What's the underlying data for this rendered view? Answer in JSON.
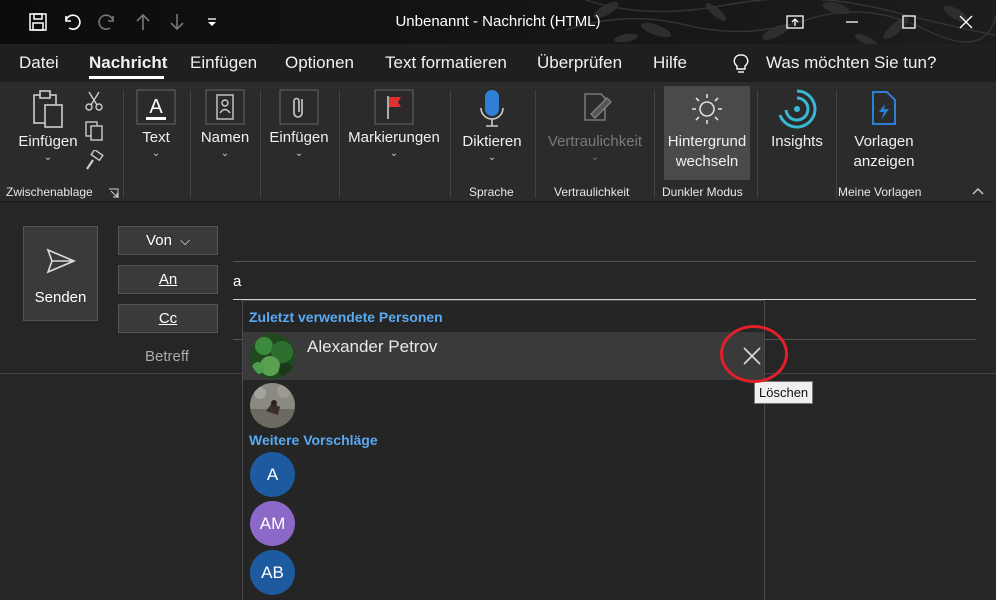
{
  "window": {
    "title": "Unbenannt  -  Nachricht (HTML)"
  },
  "quick_access": [
    "save-icon",
    "undo-icon",
    "redo-icon",
    "up-icon",
    "down-icon",
    "customize-dropdown-icon"
  ],
  "menu": {
    "items": [
      "Datei",
      "Nachricht",
      "Einfügen",
      "Optionen",
      "Text formatieren",
      "Überprüfen",
      "Hilfe"
    ],
    "active": "Nachricht",
    "search_prompt": "Was möchten Sie tun?"
  },
  "ribbon": {
    "paste": "Einfügen",
    "text": "Text",
    "names": "Namen",
    "attach": "Einfügen",
    "tags": "Markierungen",
    "dictate": "Diktieren",
    "sensitivity": "Vertraulichkeit",
    "background_line1": "Hintergrund",
    "background_line2": "wechseln",
    "insights": "Insights",
    "templates_line1": "Vorlagen",
    "templates_line2": "anzeigen",
    "groups": {
      "clipboard": "Zwischenablage",
      "voice": "Sprache",
      "sensitivity": "Vertraulichkeit",
      "darkmode": "Dunkler Modus",
      "templates": "Meine Vorlagen"
    }
  },
  "compose": {
    "send": "Senden",
    "from": "Von",
    "to": "An",
    "cc": "Cc",
    "subject": "Betreff",
    "to_value": "a"
  },
  "suggestions": {
    "recent_header": "Zuletzt verwendete Personen",
    "recent": [
      {
        "name": "Alexander Petrov"
      },
      {
        "name": ""
      }
    ],
    "more_header": "Weitere Vorschläge",
    "more": [
      {
        "initials": "A",
        "color": "#1e5aa0"
      },
      {
        "initials": "AM",
        "color": "#8c68c8"
      },
      {
        "initials": "AB",
        "color": "#1e5aa0"
      }
    ],
    "delete_tooltip": "Löschen"
  },
  "colors": {
    "accent_blue": "#5aa9f2",
    "annotation_red": "#e0202a"
  }
}
